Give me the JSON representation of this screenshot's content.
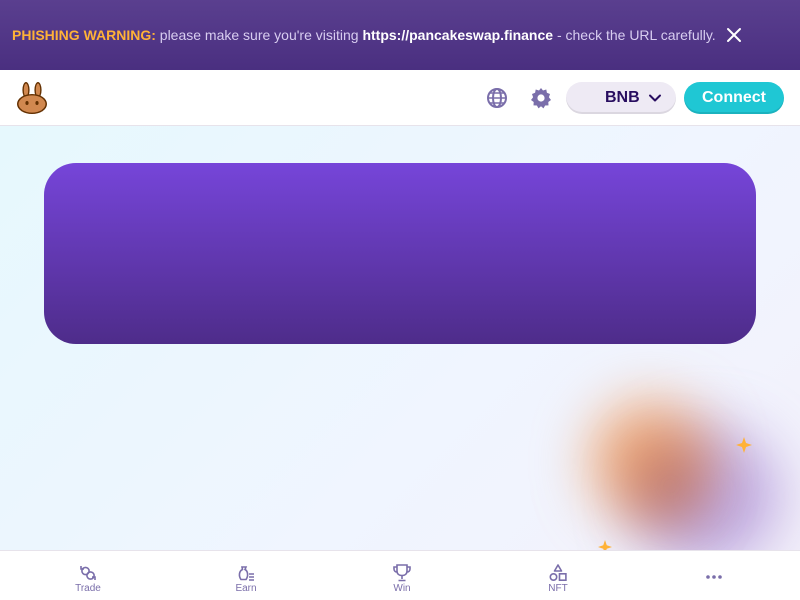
{
  "warning": {
    "label": "PHISHING WARNING:",
    "text_before": " please make sure you're visiting ",
    "url": "https://pancakeswap.finance",
    "text_after": " - check the URL carefully."
  },
  "navbar": {
    "logo_icon": "bunny-logo-icon",
    "globe_icon": "globe-icon",
    "settings_icon": "gear-icon",
    "network_label": "BNB",
    "connect_label": "Connect"
  },
  "bottom_nav": {
    "items": [
      {
        "label": "Trade",
        "icon": "trade-icon"
      },
      {
        "label": "Earn",
        "icon": "earn-icon"
      },
      {
        "label": "Win",
        "icon": "trophy-icon"
      },
      {
        "label": "NFT",
        "icon": "nft-icon"
      },
      {
        "label": "",
        "icon": "more-icon"
      }
    ]
  },
  "colors": {
    "accent": "#1fc7d4",
    "primary": "#7645d9",
    "warning": "#ffb237",
    "text": "#280d5f"
  }
}
